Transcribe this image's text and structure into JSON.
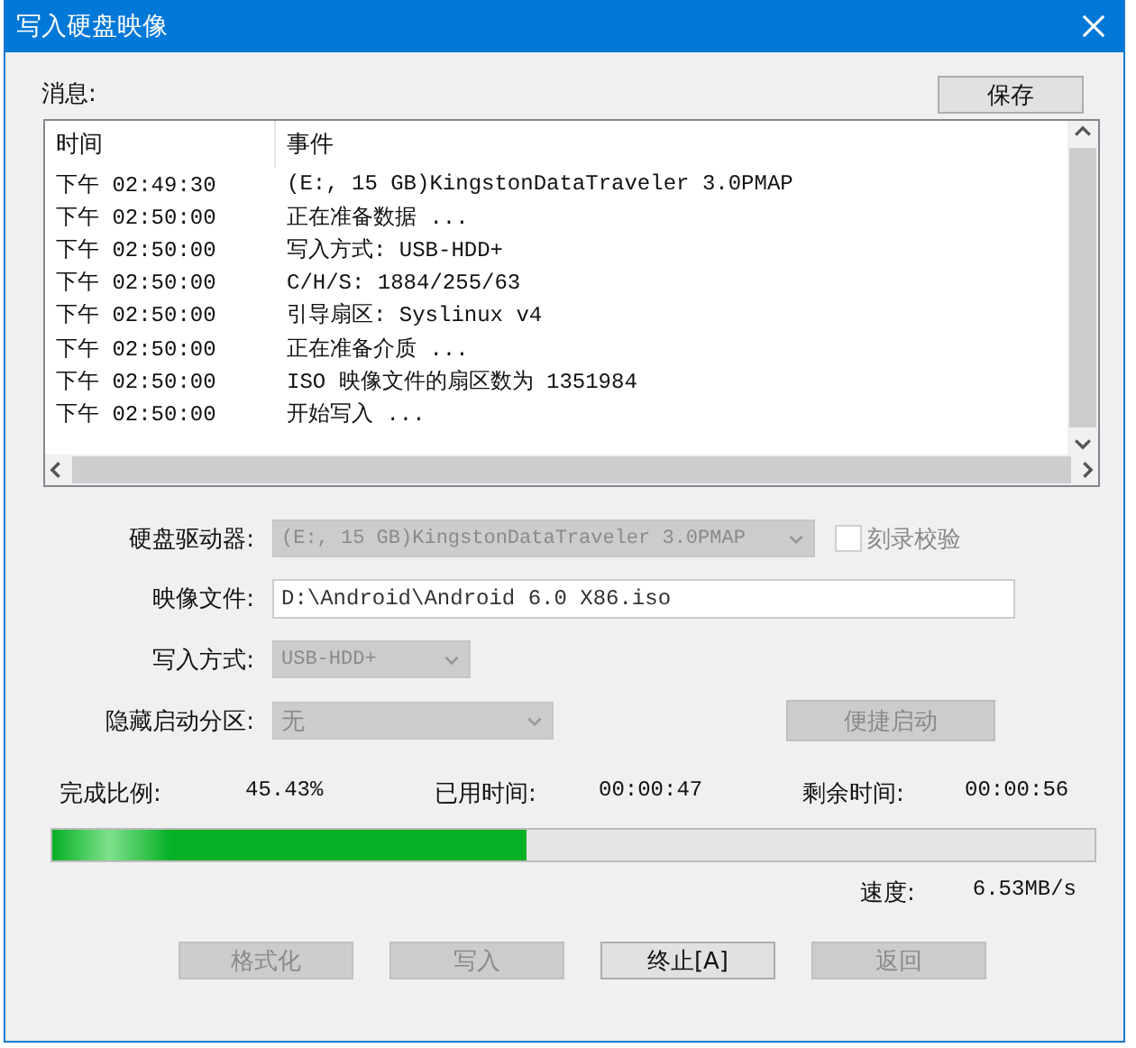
{
  "window": {
    "title": "写入硬盘映像"
  },
  "messages_label": "消息:",
  "save_button": {
    "label": "保存",
    "disabled": false
  },
  "log": {
    "columns": [
      "时间",
      "事件"
    ],
    "rows": [
      {
        "time": "下午 02:49:30",
        "event": "(E:, 15 GB)KingstonDataTraveler 3.0PMAP"
      },
      {
        "time": "下午 02:50:00",
        "event": "正在准备数据 ..."
      },
      {
        "time": "下午 02:50:00",
        "event": "写入方式: USB-HDD+"
      },
      {
        "time": "下午 02:50:00",
        "event": "C/H/S: 1884/255/63"
      },
      {
        "time": "下午 02:50:00",
        "event": "引导扇区: Syslinux v4"
      },
      {
        "time": "下午 02:50:00",
        "event": "正在准备介质 ..."
      },
      {
        "time": "下午 02:50:00",
        "event": "ISO 映像文件的扇区数为 1351984"
      },
      {
        "time": "下午 02:50:00",
        "event": "开始写入 ..."
      }
    ]
  },
  "form": {
    "drive": {
      "label": "硬盘驱动器:",
      "value": "(E:, 15 GB)KingstonDataTraveler 3.0PMAP",
      "disabled": true
    },
    "verify": {
      "label": "刻录校验",
      "checked": false,
      "disabled": true
    },
    "image_file": {
      "label": "映像文件:",
      "value": "D:\\Android\\Android 6.0 X86.iso"
    },
    "write_method": {
      "label": "写入方式:",
      "value": "USB-HDD+",
      "disabled": true
    },
    "hidden_partition": {
      "label": "隐藏启动分区:",
      "value": "无",
      "disabled": true
    },
    "quick_boot": {
      "label": "便捷启动",
      "disabled": true
    }
  },
  "progress": {
    "done_label": "完成比例:",
    "done_value": "45.43%",
    "elapsed_label": "已用时间:",
    "elapsed_value": "00:00:47",
    "remaining_label": "剩余时间:",
    "remaining_value": "00:00:56",
    "level": 0.4543,
    "speed_label": "速度:",
    "speed_value": "6.53MB/s"
  },
  "buttons": [
    {
      "label": "格式化",
      "disabled": true
    },
    {
      "label": "写入",
      "disabled": true
    },
    {
      "label": "终止[A]",
      "disabled": false
    },
    {
      "label": "返回",
      "disabled": true
    }
  ]
}
